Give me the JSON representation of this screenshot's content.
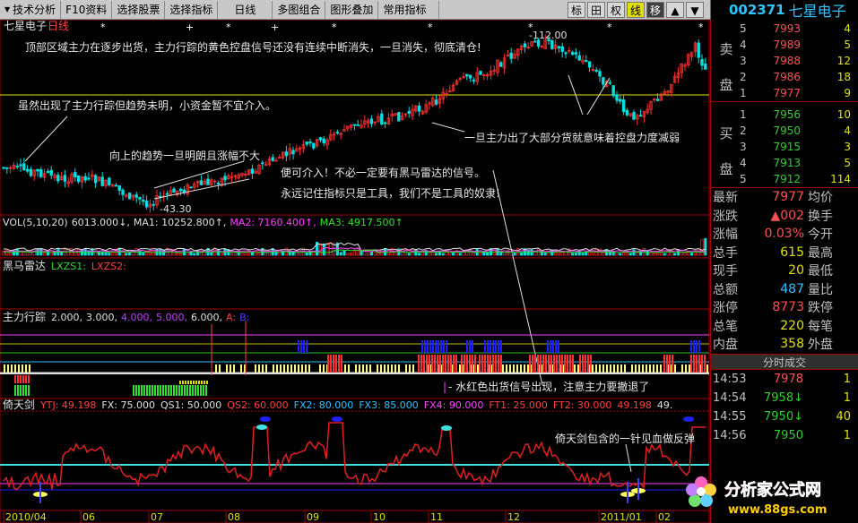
{
  "toolbar": {
    "items": [
      "技术分析",
      "F10资料",
      "选择股票",
      "选择指标",
      "日线",
      "多图组合",
      "图形叠加",
      "常用指标"
    ],
    "modes": [
      "标",
      "田",
      "权",
      "线",
      "移"
    ]
  },
  "stock": {
    "code": "002371",
    "name": "七星电子"
  },
  "main_panel": {
    "title": "七星电子",
    "period": "日线",
    "high_label": "112.00",
    "low_label": "43.30",
    "annotations": [
      "顶部区域主力在逐步出货，主力行踪的黄色控盘信号还没有连续中断消失，一旦消失，彻底清仓!",
      "虽然出现了主力行踪但趋势未明，小资金暂不宜介入。",
      "向上的趋势一旦明朗且涨幅不大",
      "便可介入！不必一定要有黑马雷达的信号。",
      "永远记住指标只是工具，我们不是工具的奴隶!",
      "一旦主力出了大部分货就意味着控盘力度减弱"
    ]
  },
  "vol_panel": {
    "label": "VOL(5,10,20)",
    "v": "6013.000",
    "ma1": "MA1: 10252.800",
    "ma2": "MA2: 7160.400",
    "ma3": "MA3: 4917.500"
  },
  "radar_panel": {
    "label": "黑马雷达",
    "l1": "LXZS1:",
    "l2": "LXZS2:"
  },
  "track_panel": {
    "label": "主力行踪",
    "params": [
      "2.000,",
      "3.000,",
      "4.000,",
      "5.000,",
      "6.000,",
      "A:",
      "B:"
    ],
    "note": "- 水红色出货信号出现，注意主力要撤退了"
  },
  "sword_panel": {
    "label": "倚天剑",
    "params": [
      "YTJ: 49.198",
      "FX: 75.000",
      "QS1: 50.000",
      "QS2: 60.000",
      "FX2: 80.000",
      "FX3: 85.000",
      "FX4: 90.000",
      "FT1: 25.000",
      "FT2: 30.000",
      "49.198",
      "49."
    ],
    "note": "倚天剑包含的一针见血做反弹"
  },
  "x_axis": [
    "2010/04",
    "06",
    "07",
    "08",
    "09",
    "10",
    "11",
    "12",
    "2011/01",
    "02"
  ],
  "order_book": {
    "sell_label": [
      "卖",
      "盘"
    ],
    "buy_label": [
      "买",
      "盘"
    ],
    "asks": [
      {
        "lvl": "5",
        "price": "7993",
        "vol": "4"
      },
      {
        "lvl": "4",
        "price": "7989",
        "vol": "5"
      },
      {
        "lvl": "3",
        "price": "7988",
        "vol": "12"
      },
      {
        "lvl": "2",
        "price": "7986",
        "vol": "18"
      },
      {
        "lvl": "1",
        "price": "7977",
        "vol": "9"
      }
    ],
    "bids": [
      {
        "lvl": "1",
        "price": "7956",
        "vol": "10"
      },
      {
        "lvl": "2",
        "price": "7950",
        "vol": "4"
      },
      {
        "lvl": "3",
        "price": "7915",
        "vol": "3"
      },
      {
        "lvl": "4",
        "price": "7913",
        "vol": "5"
      },
      {
        "lvl": "5",
        "price": "7912",
        "vol": "114"
      }
    ]
  },
  "stats": [
    {
      "l": "最新",
      "v": "7977",
      "r": "均价",
      "c": "red"
    },
    {
      "l": "涨跌",
      "v": "▲002",
      "r": "换手",
      "c": "red"
    },
    {
      "l": "涨幅",
      "v": "0.03%",
      "r": "今开",
      "c": "red"
    },
    {
      "l": "总手",
      "v": "615",
      "r": "最高",
      "c": "yel"
    },
    {
      "l": "现手",
      "v": "20",
      "r": "最低",
      "c": "yel"
    },
    {
      "l": "总额",
      "v": "487",
      "r": "量比",
      "c": "cyan"
    },
    {
      "l": "涨停",
      "v": "8773",
      "r": "跌停",
      "c": "red"
    },
    {
      "l": "总笔",
      "v": "220",
      "r": "每笔",
      "c": "yel"
    },
    {
      "l": "内盘",
      "v": "358",
      "r": "外盘",
      "c": "yel"
    }
  ],
  "ticks_title": "分时成交",
  "ticks": [
    {
      "t": "14:53",
      "p": "7978",
      "d": "",
      "v": "1",
      "c": "red"
    },
    {
      "t": "14:54",
      "p": "7958",
      "d": "↓",
      "v": "1",
      "c": "green"
    },
    {
      "t": "14:55",
      "p": "7950",
      "d": "↓",
      "v": "40",
      "c": "green"
    },
    {
      "t": "14:56",
      "p": "7950",
      "d": "",
      "v": "1",
      "c": "green"
    }
  ],
  "watermark": {
    "line1": "分析家公式网",
    "line2": "www.88gs.com"
  },
  "colors": {
    "up": "#ff3030",
    "down": "#00e0e0",
    "bg": "#000000",
    "border": "#a00000",
    "yellow": "#e0e000",
    "magenta": "#ff00ff",
    "blue": "#2020ff"
  }
}
